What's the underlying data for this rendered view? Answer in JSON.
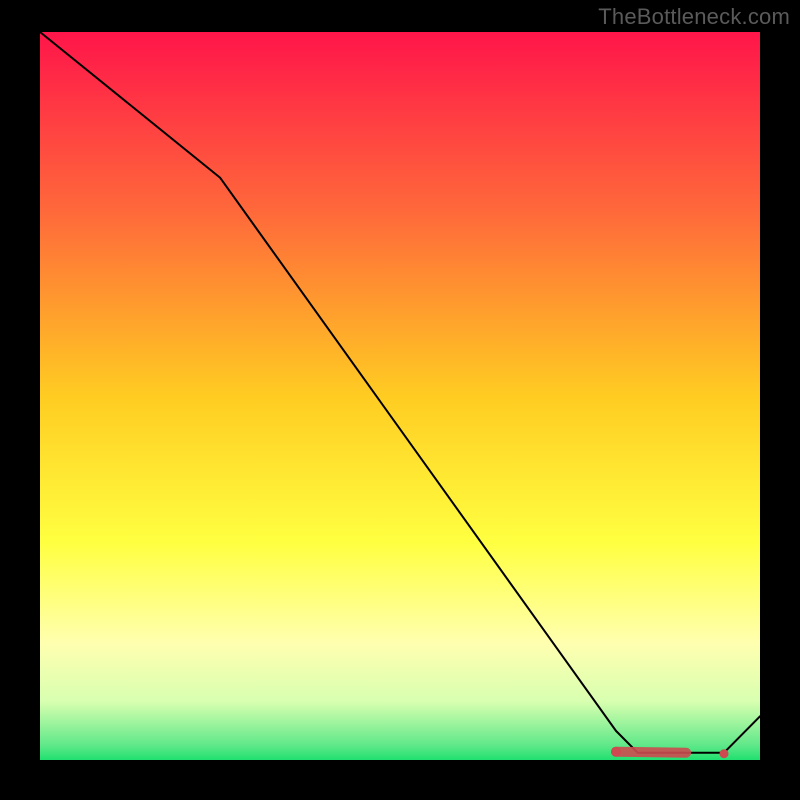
{
  "attribution": "TheBottleneck.com",
  "chart_data": {
    "type": "line",
    "title": "",
    "xlabel": "",
    "ylabel": "",
    "xlim": [
      0,
      100
    ],
    "ylim": [
      0,
      100
    ],
    "series": [
      {
        "name": "bottleneck-curve",
        "x": [
          0,
          25,
          80,
          83,
          92,
          95,
          100
        ],
        "y": [
          100,
          80,
          4,
          1,
          1,
          1,
          6
        ]
      }
    ],
    "markers": {
      "name": "red-marker-band",
      "x_start": 80,
      "x_end": 95,
      "y": 1
    },
    "background_gradient_stops": [
      {
        "offset": 0,
        "color": "#ff154a"
      },
      {
        "offset": 25,
        "color": "#ff6a3a"
      },
      {
        "offset": 50,
        "color": "#ffcc22"
      },
      {
        "offset": 70,
        "color": "#ffff40"
      },
      {
        "offset": 84,
        "color": "#ffffb0"
      },
      {
        "offset": 92,
        "color": "#d8ffb0"
      },
      {
        "offset": 98,
        "color": "#5fe889"
      },
      {
        "offset": 100,
        "color": "#20e070"
      }
    ]
  }
}
